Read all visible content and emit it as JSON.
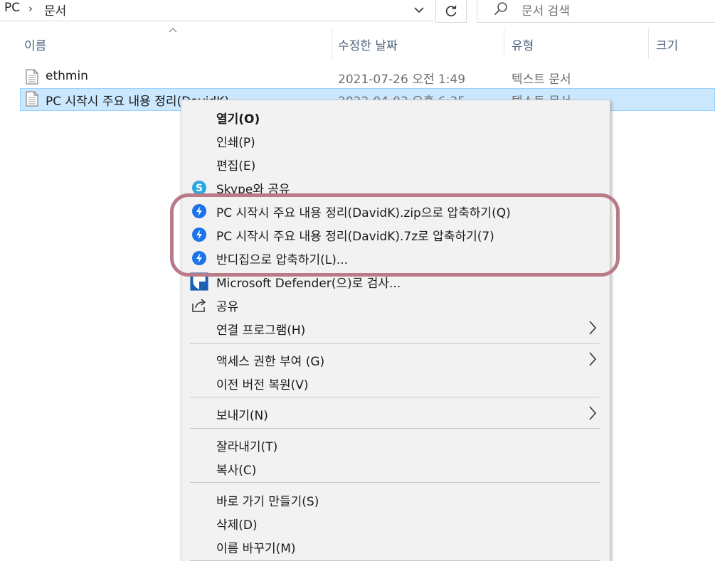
{
  "address": {
    "crumbs": [
      "PC",
      "문서"
    ],
    "separator": "›",
    "search_placeholder": "문서 검색"
  },
  "columns": {
    "name": "이름",
    "date": "수정한 날짜",
    "type": "유형",
    "size": "크기"
  },
  "files": [
    {
      "name": "ethmin",
      "date": "2021-07-26 오전 1:49",
      "type": "텍스트 문서",
      "selected": false
    },
    {
      "name": "PC 시작시 주요 내용 정리(DavidK)",
      "date": "2022-04-03 오후 6:35",
      "type": "텍스트 문서",
      "selected": true
    }
  ],
  "context_menu": {
    "open": "열기(O)",
    "print": "인쇄(P)",
    "edit": "편집(E)",
    "skype_share": "Skype와 공유",
    "zip": "PC 시작시 주요 내용 정리(DavidK).zip으로 압축하기(Q)",
    "sevenz": "PC 시작시 주요 내용 정리(DavidK).7z로 압축하기(7)",
    "bandizip": "반디집으로 압축하기(L)...",
    "defender": "Microsoft Defender(으)로 검사...",
    "share": "공유",
    "open_with": "연결 프로그램(H)",
    "give_access": "액세스 권한 부여 (G)",
    "restore": "이전 버전 복원(V)",
    "send_to": "보내기(N)",
    "cut": "잘라내기(T)",
    "copy": "복사(C)",
    "shortcut": "바로 가기 만들기(S)",
    "delete": "삭제(D)",
    "rename": "이름 바꾸기(M)"
  },
  "colors": {
    "highlight_border": "#b87b87",
    "selection_bg": "#cce8ff",
    "skype": "#2aa7e0",
    "bandizip": "#1a73e8"
  }
}
